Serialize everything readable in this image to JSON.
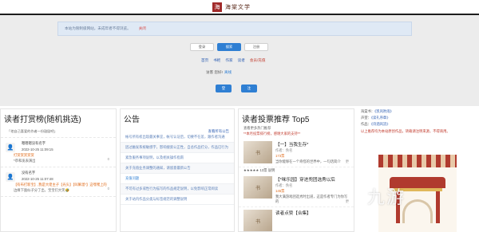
{
  "header": {
    "logo_text": "海棠文学",
    "logo_seal": "海"
  },
  "notice": {
    "text": "本站为限制级网站，未成年者不得浏览。",
    "close": "关闭"
  },
  "tabs": [
    {
      "label": "登录",
      "active": false
    },
    {
      "label": "搜索",
      "active": true
    },
    {
      "label": "注册",
      "active": false
    }
  ],
  "nav": [
    {
      "label": "首页",
      "red": false
    },
    {
      "label": "书柜",
      "red": false
    },
    {
      "label": "作家",
      "red": false
    },
    {
      "label": "读者",
      "red": false
    },
    {
      "label": "会员/充值",
      "red": true
    }
  ],
  "visitor": {
    "label": "访客 您好!",
    "extra": "离线"
  },
  "actions": {
    "primary": "登",
    "secondary": "注"
  },
  "reward_panel": {
    "title": "读者打赏榜(随机挑选)",
    "intro": "「他自己喜爱的作者一份鼓励吧」",
    "items": [
      {
        "name": "嗯嗯嗯没有名字",
        "time": "2022-10-25 11:09:15",
        "msg": "打赏赏赏赏赏",
        "msg2": "*恭和发表演出",
        "like": "0"
      },
      {
        "name": "没有名字",
        "time": "2022-10-25 11:07:48",
        "msg": "【有布打新宝】,我是大佬主子【光头】【叫嘛溜*】这嘿嘿上的",
        "msg2": "边缘下面似子分了出，宝宝们大笑🤣",
        "like": "0"
      }
    ]
  },
  "announce_panel": {
    "title": "公告",
    "more": "查看所有公告",
    "items": [
      {
        "text": "帐号所有权出现最关事宜，帐号认证后，切要不在差，跟作者沟通",
        "stripe": false,
        "blue": false
      },
      {
        "text": "因过触发系统敏感字，影响搜索公正性，自总作品打分，作品已行为",
        "stripe": true,
        "blue": false
      },
      {
        "text": "紧急服务事项说明，以及相关操作指南",
        "stripe": false,
        "blue": false
      },
      {
        "text": "关于充值业务调整的通知，请留意最新公告",
        "stripe": true,
        "blue": false
      },
      {
        "text": "充值问题",
        "stripe": false,
        "blue": true
      },
      {
        "text": "不可有过多或性行为描写的作品规定说明，以免影响正常阅读",
        "stripe": true,
        "blue": false
      },
      {
        "text": "关于站内作品分类与标签规范的调整说明",
        "stripe": false,
        "blue": false
      }
    ]
  },
  "vote_panel": {
    "title": "读者投票推荐 Top5",
    "sub": "查看更多热门推荐",
    "sub2": "**本月投票排行榜，感谢大家的支持**",
    "books": [
      {
        "cover": "书",
        "title": "【一】当我生存*",
        "author": "作者：佚名",
        "score": "173票",
        "desc": "当你能够在一个奇怪的世界中，一句话简介",
        "pages": "更"
      },
      {
        "cover": "书",
        "title": "【*咪乐园】穿进兜团选秀以后",
        "author": "作者：佚名",
        "score": "145票",
        "desc": "我大满游戏团选秀时出道，这是作者专门为你写的",
        "pages": "更"
      },
      {
        "cover": "书",
        "title": "读者点赞【合集】",
        "author": "作者：佚名",
        "score": "",
        "desc": "",
        "pages": ""
      }
    ],
    "stars_row": "★★★★★ 13票 说明"
  },
  "sidebar": {
    "lines": [
      {
        "text": "海棠书：",
        "link": "《凯风吹雨》",
        "red": false
      },
      {
        "text": "声望：",
        "link": "《读礼序章》",
        "red": false
      },
      {
        "text": "作品：",
        "link": "《诗酒风流》",
        "red": false
      },
      {
        "text": "以上推荐均为本站原创作品，转载请注明来源，不得商用。",
        "link": "",
        "red": true
      }
    ]
  },
  "watermark": "九游",
  "colors": {
    "accent": "#2f7fd3",
    "topline": "#1d1d1d",
    "notice_bg": "#dfe9f5",
    "band": "#ececec"
  }
}
